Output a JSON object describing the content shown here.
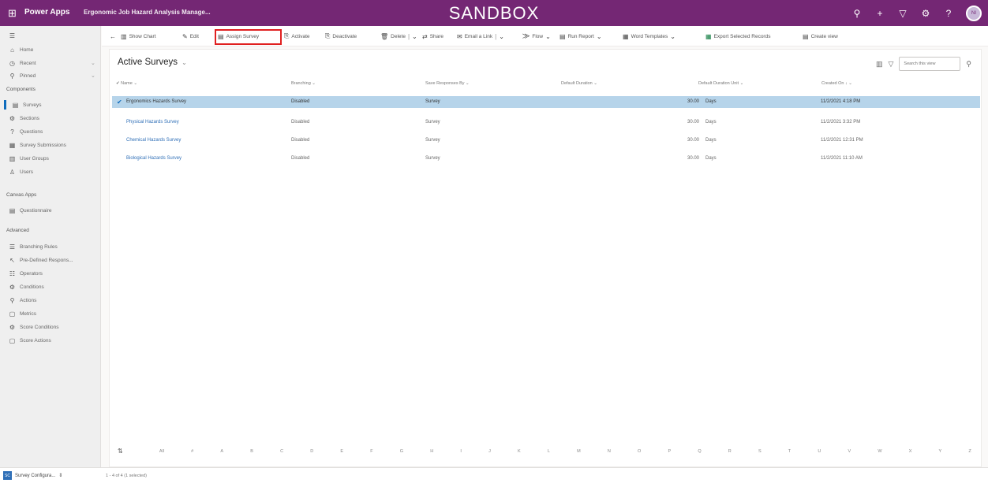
{
  "topbar": {
    "waffle_icon": "waffle-icon",
    "brand": "Power Apps",
    "app_name": "Ergonomic Job Hazard Analysis Manage...",
    "environment": "SANDBOX",
    "icons": [
      "search-icon",
      "plus-icon",
      "filter-icon",
      "settings-icon",
      "help-icon"
    ],
    "avatar": "NI",
    "bg_color": "#742774"
  },
  "nav": {
    "top": [
      {
        "label": "",
        "icon": "☰"
      },
      {
        "label": "Home",
        "icon": "⌂"
      },
      {
        "label": "Recent",
        "icon": "◷",
        "chevron": "⌄"
      },
      {
        "label": "Pinned",
        "icon": "⚲",
        "chevron": "⌄"
      }
    ],
    "components_header": "Components",
    "components": [
      {
        "label": "Surveys",
        "icon": "▤",
        "active": true
      },
      {
        "label": "Sections",
        "icon": "⚙"
      },
      {
        "label": "Questions",
        "icon": "?"
      },
      {
        "label": "Survey Submissions",
        "icon": "▦"
      },
      {
        "label": "User Groups",
        "icon": "▥"
      },
      {
        "label": "Users",
        "icon": "♙"
      }
    ],
    "canvas_header": "Canvas Apps",
    "canvas": [
      {
        "label": "Questionnaire",
        "icon": "▤"
      }
    ],
    "advanced_header": "Advanced",
    "advanced": [
      {
        "label": "Branching Rules",
        "icon": "☰"
      },
      {
        "label": "Pre-Defined Respons...",
        "icon": "↖"
      },
      {
        "label": "Operators",
        "icon": "☷"
      },
      {
        "label": "Conditions",
        "icon": "⚙"
      },
      {
        "label": "Actions",
        "icon": "⚲"
      },
      {
        "label": "Metrics",
        "icon": "▢"
      },
      {
        "label": "Score Conditions",
        "icon": "⚙"
      },
      {
        "label": "Score Actions",
        "icon": "▢"
      }
    ]
  },
  "commands": [
    {
      "label": "",
      "icon": "←"
    },
    {
      "label": "Show Chart",
      "icon": "▥"
    },
    {
      "label": "Edit",
      "icon": "✎"
    },
    {
      "label": "Assign Survey",
      "icon": "▤"
    },
    {
      "label": "Activate",
      "icon": "⎘"
    },
    {
      "label": "Deactivate",
      "icon": "⎘"
    },
    {
      "label": "Delete",
      "icon": "🗑",
      "split": true
    },
    {
      "label": "Share",
      "icon": "⇄"
    },
    {
      "label": "Email a Link",
      "icon": "✉",
      "split": true
    },
    {
      "label": "Flow",
      "icon": "⨠",
      "chevron": true
    },
    {
      "label": "Run Report",
      "icon": "▤",
      "chevron": true
    },
    {
      "label": "Word Templates",
      "icon": "▦",
      "chevron": true
    },
    {
      "label": "Export Selected Records",
      "icon": "▦",
      "excel": true
    },
    {
      "label": "Create view",
      "icon": "▤"
    }
  ],
  "view": {
    "title": "Active Surveys",
    "search_placeholder": "Search this view",
    "columns": [
      "Name",
      "Branching",
      "Save Responses By",
      "Default Duration",
      "Default Duration Unit",
      "Created On"
    ],
    "rows": [
      {
        "name": "Ergonomics Hazards Survey",
        "branching": "Disabled",
        "save_by": "Survey",
        "duration": "30.00",
        "unit": "Days",
        "created": "11/2/2021 4:18 PM",
        "selected": true
      },
      {
        "name": "Physical Hazards Survey",
        "branching": "Disabled",
        "save_by": "Survey",
        "duration": "30.00",
        "unit": "Days",
        "created": "11/2/2021 3:32 PM",
        "selected": false
      },
      {
        "name": "Chemical Hazards Survey",
        "branching": "Disabled",
        "save_by": "Survey",
        "duration": "30.00",
        "unit": "Days",
        "created": "11/2/2021 12:31 PM",
        "selected": false
      },
      {
        "name": "Biological Hazards Survey",
        "branching": "Disabled",
        "save_by": "Survey",
        "duration": "30.00",
        "unit": "Days",
        "created": "11/2/2021 11:10 AM",
        "selected": false
      }
    ],
    "alpha": [
      "All",
      "#",
      "A",
      "B",
      "C",
      "D",
      "E",
      "F",
      "G",
      "H",
      "I",
      "J",
      "K",
      "L",
      "M",
      "N",
      "O",
      "P",
      "Q",
      "R",
      "S",
      "T",
      "U",
      "V",
      "W",
      "X",
      "Y",
      "Z"
    ]
  },
  "footer": {
    "area_badge": "SC",
    "area": "Survey Configura...",
    "row_count": "1 - 4 of 4 (1 selected)"
  }
}
